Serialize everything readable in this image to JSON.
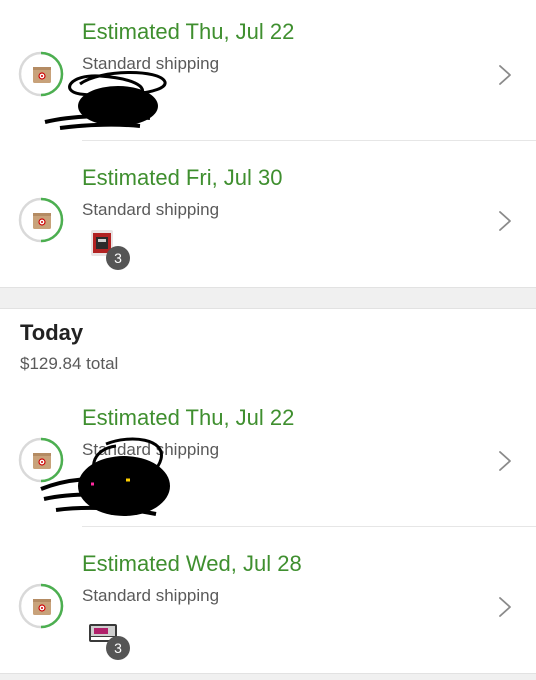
{
  "groups": [
    {
      "title": "",
      "total": "",
      "shipments": [
        {
          "estimate": "Estimated Thu, Jul 22",
          "method": "Standard shipping",
          "item_count": ""
        },
        {
          "estimate": "Estimated Fri, Jul 30",
          "method": "Standard shipping",
          "item_count": "3"
        }
      ]
    },
    {
      "title": "Today",
      "total": "$129.84 total",
      "shipments": [
        {
          "estimate": "Estimated Thu, Jul 22",
          "method": "Standard shipping",
          "item_count": ""
        },
        {
          "estimate": "Estimated Wed, Jul 28",
          "method": "Standard shipping",
          "item_count": "3"
        }
      ]
    }
  ],
  "colors": {
    "estimate_green": "#3f8f2f",
    "progress_green": "#4caf50",
    "ring_track": "#d9d9d9",
    "target_red": "#cc0000",
    "box_tan": "#c8a27a",
    "badge_gray": "#555555"
  },
  "icons": {
    "status": "package-progress-icon",
    "navigation": "chevron-right-icon"
  }
}
